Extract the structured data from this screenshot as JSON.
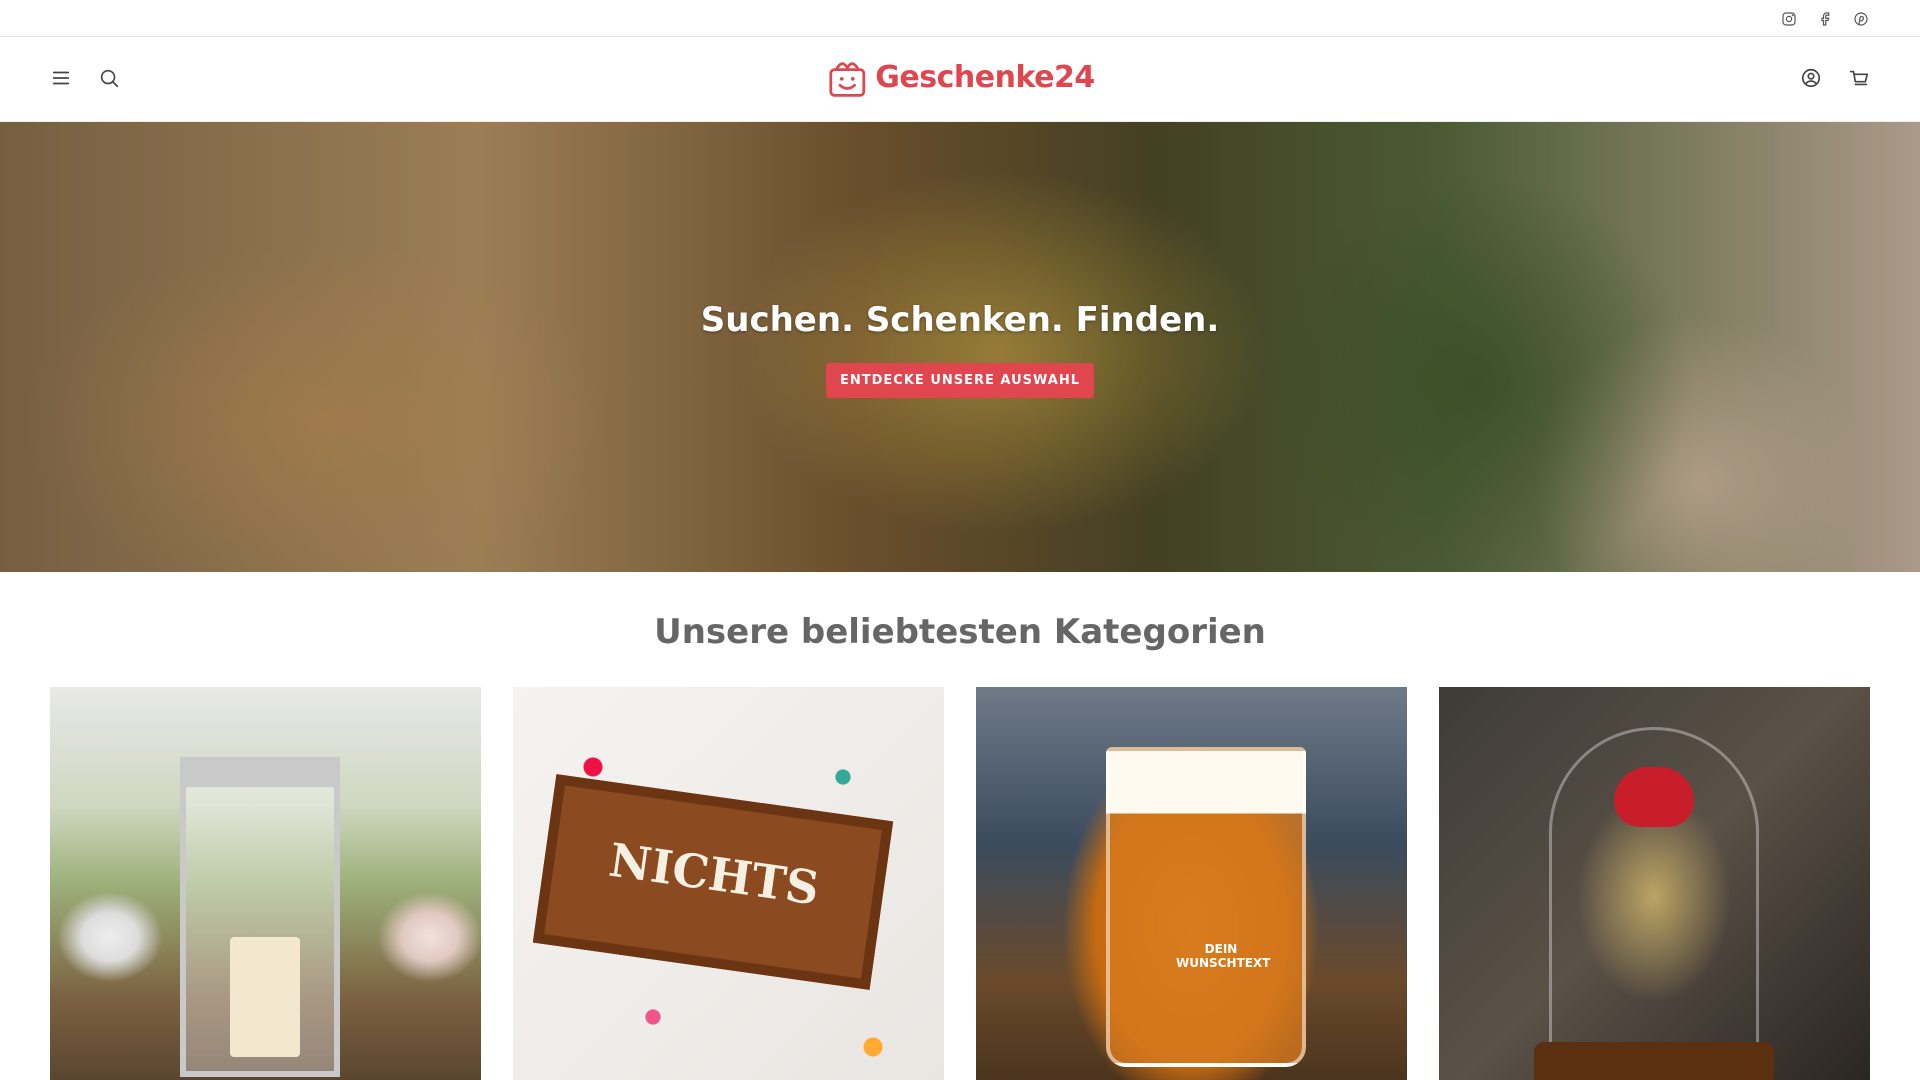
{
  "brand": {
    "name": "Geschenke24",
    "accent": "#e0464e"
  },
  "social": [
    {
      "name": "instagram-icon",
      "label": "Instagram"
    },
    {
      "name": "facebook-icon",
      "label": "Facebook"
    },
    {
      "name": "pinterest-icon",
      "label": "Pinterest"
    }
  ],
  "header": {
    "left_icons": [
      "menu-icon",
      "search-icon"
    ],
    "right_icons": [
      "account-icon",
      "cart-icon"
    ]
  },
  "hero": {
    "title": "Suchen. Schenken. Finden.",
    "button_label": "ENTDECKE UNSERE AUSWAHL"
  },
  "categories": {
    "title": "Unsere beliebtesten Kategorien",
    "items": [
      {
        "image": "lantern-candle",
        "overlay": ""
      },
      {
        "image": "money-gift-box",
        "overlay": "NICHTS"
      },
      {
        "image": "beer-mug",
        "overlay": "DEIN WUNSCHTEXT"
      },
      {
        "image": "rose-dome",
        "overlay": ""
      }
    ]
  }
}
